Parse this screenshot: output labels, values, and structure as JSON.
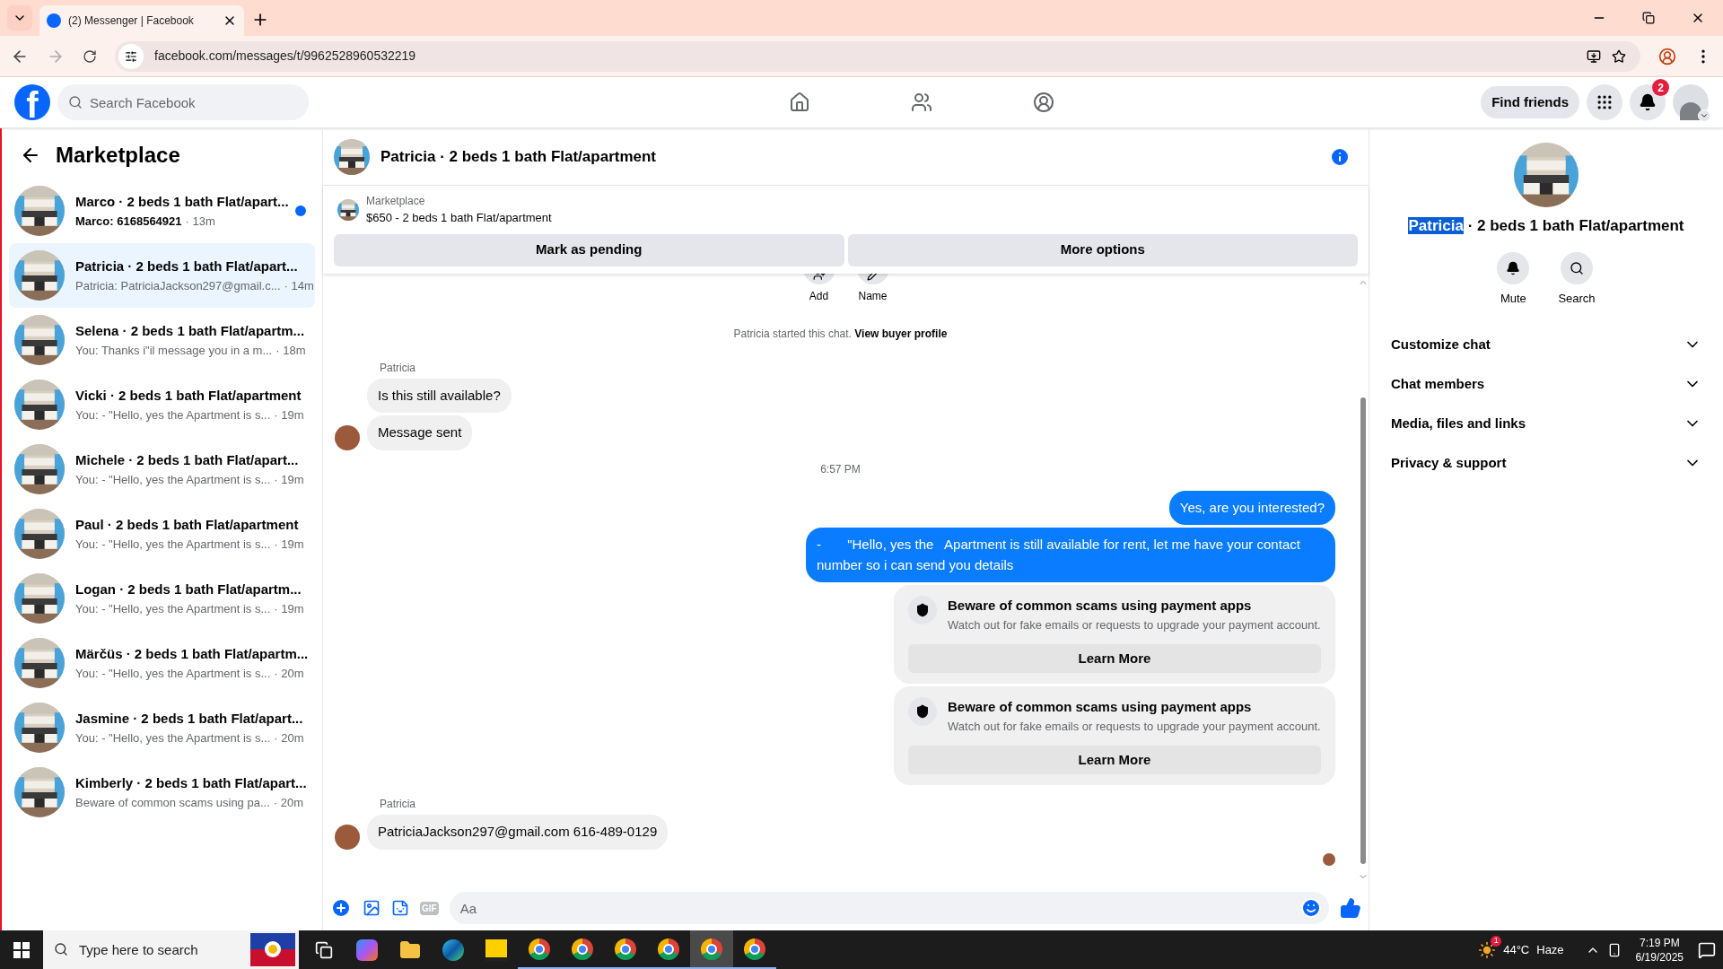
{
  "browser": {
    "tab_title": "(2) Messenger | Facebook",
    "url": "facebook.com/messages/t/9962528960532219",
    "forward_disabled": true
  },
  "header": {
    "logo": "f",
    "search_placeholder": "Search Facebook",
    "find_friends": "Find friends",
    "notification_count": "2"
  },
  "sidebar": {
    "title": "Marketplace",
    "conversations": [
      {
        "title": "Marco · 2 beds 1 bath Flat/apart...",
        "preview": "Marco: 6168564921",
        "time": "· 13m",
        "unread": true,
        "selected": false
      },
      {
        "title": "Patricia · 2 beds 1 bath Flat/apart...",
        "preview": "Patricia: PatriciaJackson297@gmail.c...",
        "time": "· 14m",
        "unread": false,
        "selected": true
      },
      {
        "title": "Selena · 2 beds 1 bath Flat/apartm...",
        "preview": "You: Thanks i\"il message you in a m...",
        "time": "· 18m",
        "unread": false,
        "selected": false
      },
      {
        "title": "Vicki · 2 beds 1 bath Flat/apartment",
        "preview": "You: - \"Hello, yes the Apartment is s...",
        "time": "· 19m",
        "unread": false,
        "selected": false
      },
      {
        "title": "Michele · 2 beds 1 bath Flat/apart...",
        "preview": "You: - \"Hello, yes the Apartment is s...",
        "time": "· 19m",
        "unread": false,
        "selected": false
      },
      {
        "title": "Paul · 2 beds 1 bath Flat/apartment",
        "preview": "You: - \"Hello, yes the Apartment is s...",
        "time": "· 19m",
        "unread": false,
        "selected": false
      },
      {
        "title": "Logan · 2 beds 1 bath Flat/apartm...",
        "preview": "You: - \"Hello, yes the Apartment is s...",
        "time": "· 19m",
        "unread": false,
        "selected": false
      },
      {
        "title": "Märčüs · 2 beds 1 bath Flat/apartm...",
        "preview": "You: - \"Hello, yes the Apartment is s...",
        "time": "· 20m",
        "unread": false,
        "selected": false
      },
      {
        "title": "Jasmine · 2 beds 1 bath Flat/apart...",
        "preview": "You: - \"Hello, yes the Apartment is s...",
        "time": "· 20m",
        "unread": false,
        "selected": false
      },
      {
        "title": "Kimberly · 2 beds 1 bath Flat/apart...",
        "preview": "Beware of common scams using pa...",
        "time": "· 20m",
        "unread": false,
        "selected": false
      }
    ]
  },
  "chat": {
    "title": "Patricia · 2 beds 1 bath Flat/apartment",
    "listing": {
      "label": "Marketplace",
      "title": "$650 - 2 beds 1 bath Flat/apartment"
    },
    "actions": [
      "Mark as pending",
      "More options"
    ],
    "top_actions": [
      {
        "kind": "add",
        "label": "Add"
      },
      {
        "kind": "name",
        "label": "Name"
      }
    ],
    "started": {
      "text": "Patricia started this chat.",
      "link": "View buyer profile"
    },
    "messages": [
      {
        "kind": "sender",
        "text": "Patricia"
      },
      {
        "kind": "incoming",
        "text": "Is this still available?",
        "avatar": false
      },
      {
        "kind": "incoming",
        "text": "Message sent",
        "avatar": true
      },
      {
        "kind": "time",
        "text": "6:57 PM"
      },
      {
        "kind": "outgoing",
        "text": "Yes, are you interested?"
      },
      {
        "kind": "outgoing",
        "text": "-       \"Hello, yes the   Apartment is still available for rent, let me have your contact number so i can send you details"
      },
      {
        "kind": "notice",
        "title": "Beware of common scams using payment apps",
        "body": "Watch out for fake emails or requests to upgrade your payment account.",
        "button": "Learn More"
      },
      {
        "kind": "notice",
        "title": "Beware of common scams using payment apps",
        "body": "Watch out for fake emails or requests to upgrade your payment account.",
        "button": "Learn More"
      },
      {
        "kind": "sender",
        "text": "Patricia"
      },
      {
        "kind": "incoming",
        "text": "PatriciaJackson297@gmail.com 616-489-0129",
        "avatar": true
      }
    ],
    "read_receipt": true,
    "composer": {
      "placeholder": "Aa",
      "gif": "GIF"
    }
  },
  "right_panel": {
    "title_selected": "Patricia",
    "title_rest": " · 2 beds 1 bath Flat/apartment",
    "actions": [
      {
        "kind": "mute",
        "label": "Mute"
      },
      {
        "kind": "search",
        "label": "Search"
      }
    ],
    "sections": [
      "Customize chat",
      "Chat members",
      "Media, files and links",
      "Privacy & support"
    ]
  },
  "taskbar": {
    "search_placeholder": "Type here to search",
    "apps": [
      {
        "kind": "taskview",
        "selected": false
      },
      {
        "kind": "copilot",
        "selected": false
      },
      {
        "kind": "folder",
        "selected": false
      },
      {
        "kind": "edge",
        "selected": false
      },
      {
        "kind": "notes",
        "selected": false
      },
      {
        "kind": "chrome",
        "selected": false
      },
      {
        "kind": "chrome",
        "selected": false
      },
      {
        "kind": "chrome",
        "selected": false
      },
      {
        "kind": "chrome",
        "selected": false
      },
      {
        "kind": "chrome",
        "selected": true
      },
      {
        "kind": "chrome",
        "selected": false
      }
    ],
    "weather": {
      "badge": "1",
      "temp": "44°C",
      "condition": "Haze"
    },
    "time": "7:19 PM",
    "date": "6/19/2025"
  }
}
